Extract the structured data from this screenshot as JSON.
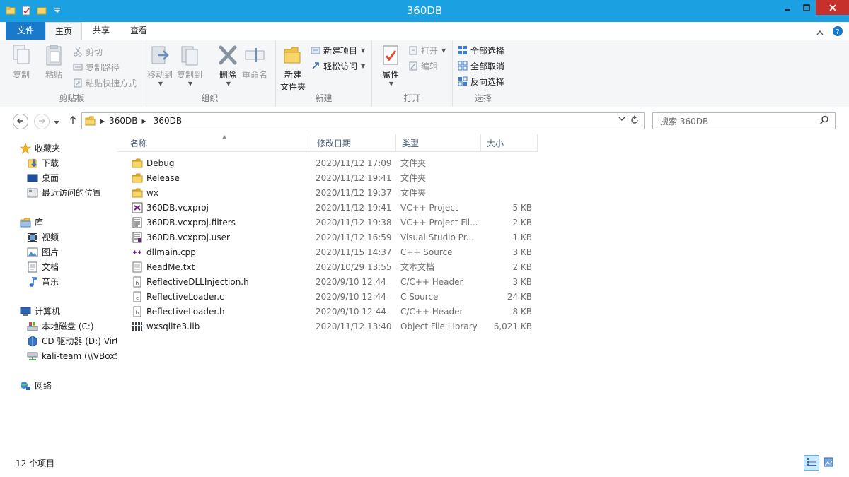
{
  "window": {
    "title": "360DB"
  },
  "tabs": {
    "file": "文件",
    "home": "主页",
    "share": "共享",
    "view": "查看"
  },
  "ribbon": {
    "clipboard": {
      "label": "剪贴板",
      "copy": "复制",
      "paste": "粘贴",
      "cut": "剪切",
      "copy_path": "复制路径",
      "paste_shortcut": "粘贴快捷方式"
    },
    "organize": {
      "label": "组织",
      "move_to": "移动到",
      "copy_to": "复制到",
      "delete": "删除",
      "rename": "重命名"
    },
    "new": {
      "label": "新建",
      "new_folder_line1": "新建",
      "new_folder_line2": "文件夹",
      "new_item": "新建项目",
      "easy_access": "轻松访问"
    },
    "open": {
      "label": "打开",
      "properties": "属性",
      "open": "打开",
      "edit": "编辑"
    },
    "select": {
      "label": "选择",
      "select_all": "全部选择",
      "select_none": "全部取消",
      "invert": "反向选择"
    }
  },
  "address": {
    "crumbs": [
      "360DB",
      "360DB"
    ],
    "search_placeholder": "搜索 360DB"
  },
  "nav": {
    "favorites": "收藏夹",
    "downloads": "下载",
    "desktop": "桌面",
    "recent": "最近访问的位置",
    "libraries": "库",
    "videos": "视频",
    "pictures": "图片",
    "documents": "文档",
    "music": "音乐",
    "computer": "计算机",
    "local_disk": "本地磁盘 (C:)",
    "cd_drive": "CD 驱动器 (D:) Virt",
    "kali": "kali-team (\\\\VBoxS",
    "network": "网络"
  },
  "columns": {
    "name": "名称",
    "date": "修改日期",
    "type": "类型",
    "size": "大小"
  },
  "files": [
    {
      "name": "Debug",
      "date": "2020/11/12 17:09",
      "type": "文件夹",
      "size": "",
      "icon": "folder-icon"
    },
    {
      "name": "Release",
      "date": "2020/11/12 19:41",
      "type": "文件夹",
      "size": "",
      "icon": "folder-icon"
    },
    {
      "name": "wx",
      "date": "2020/11/12 19:37",
      "type": "文件夹",
      "size": "",
      "icon": "folder-icon"
    },
    {
      "name": "360DB.vcxproj",
      "date": "2020/11/12 19:41",
      "type": "VC++ Project",
      "size": "5 KB",
      "icon": "vcxproj-icon"
    },
    {
      "name": "360DB.vcxproj.filters",
      "date": "2020/11/12 19:38",
      "type": "VC++ Project Fil...",
      "size": "2 KB",
      "icon": "filters-icon"
    },
    {
      "name": "360DB.vcxproj.user",
      "date": "2020/11/12 16:59",
      "type": "Visual Studio Pr...",
      "size": "1 KB",
      "icon": "user-file-icon"
    },
    {
      "name": "dllmain.cpp",
      "date": "2020/11/15 14:37",
      "type": "C++ Source",
      "size": "3 KB",
      "icon": "cpp-icon"
    },
    {
      "name": "ReadMe.txt",
      "date": "2020/10/29 13:55",
      "type": "文本文档",
      "size": "2 KB",
      "icon": "text-file-icon"
    },
    {
      "name": "ReflectiveDLLInjection.h",
      "date": "2020/9/10 12:44",
      "type": "C/C++ Header",
      "size": "3 KB",
      "icon": "header-file-icon"
    },
    {
      "name": "ReflectiveLoader.c",
      "date": "2020/9/10 12:44",
      "type": "C Source",
      "size": "24 KB",
      "icon": "c-file-icon"
    },
    {
      "name": "ReflectiveLoader.h",
      "date": "2020/9/10 12:44",
      "type": "C/C++ Header",
      "size": "8 KB",
      "icon": "header-file-icon"
    },
    {
      "name": "wxsqlite3.lib",
      "date": "2020/11/12 13:40",
      "type": "Object File Library",
      "size": "6,021 KB",
      "icon": "library-icon"
    }
  ],
  "status": {
    "item_count": "12 个项目"
  },
  "colors": {
    "titlebar": "#1ba1e2",
    "file_tab": "#1979ca",
    "close": "#c7312b",
    "folder": "#f0c14b"
  }
}
